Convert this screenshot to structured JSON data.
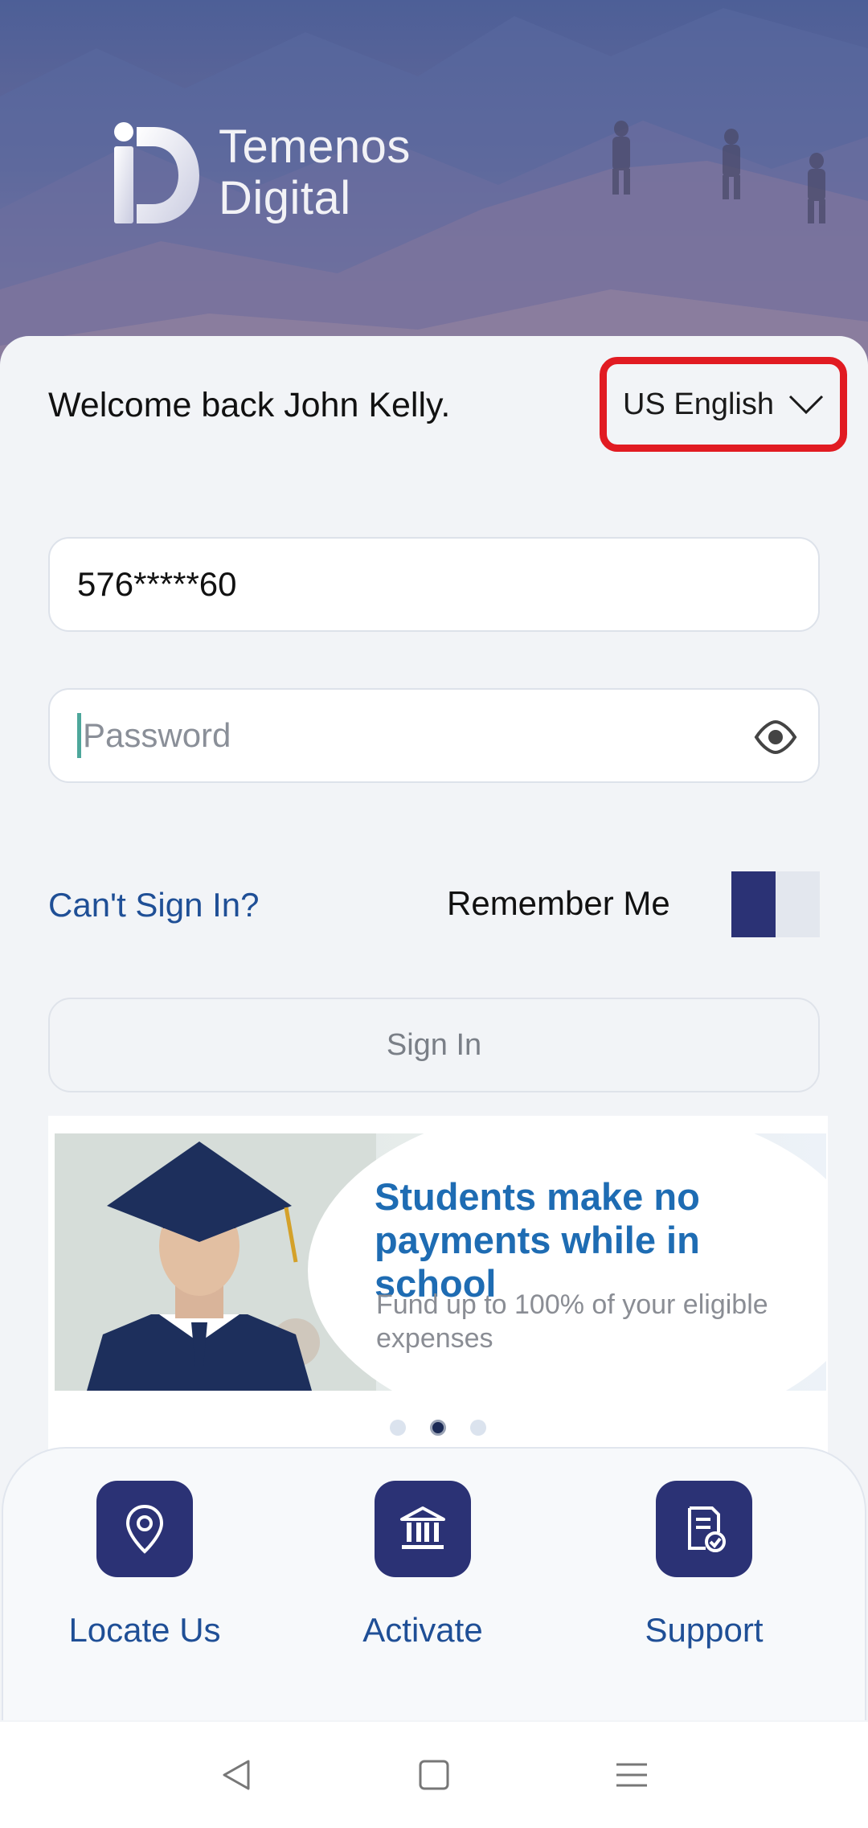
{
  "brand": {
    "line1": "Temenos",
    "line2": "Digital"
  },
  "login": {
    "welcome": "Welcome back John Kelly.",
    "language": "US English",
    "username_value": "576*****60",
    "password_placeholder": "Password",
    "cant_sign_in": "Can't Sign In?",
    "remember_me": "Remember Me",
    "sign_in": "Sign In"
  },
  "banner": {
    "headline": "Students make no payments while in school",
    "subtext": "Fund up to 100% of your eligible expenses",
    "slides_total": 3,
    "active_slide": 2
  },
  "quick_actions": [
    {
      "label": "Locate Us",
      "icon": "location-pin-icon"
    },
    {
      "label": "Activate",
      "icon": "bank-icon"
    },
    {
      "label": "Support",
      "icon": "document-check-icon"
    }
  ],
  "colors": {
    "primary": "#2b3275",
    "link": "#1f4f96",
    "highlight": "#e11b22",
    "banner_headline": "#1e6cb3"
  }
}
